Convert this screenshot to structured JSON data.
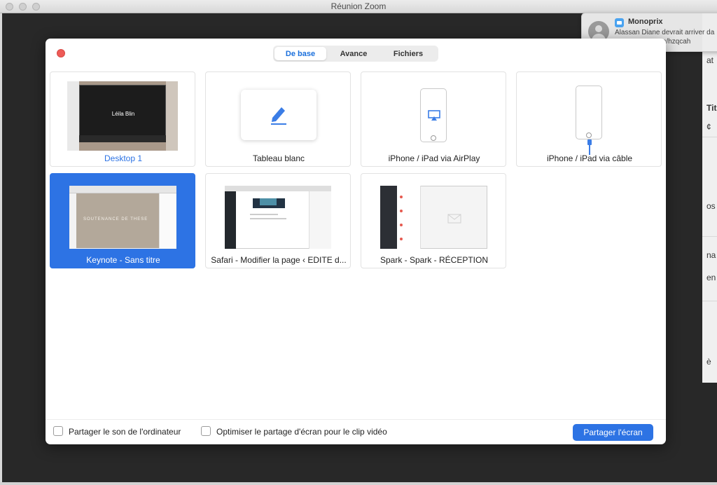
{
  "window": {
    "title": "Réunion Zoom"
  },
  "notification": {
    "sender": "Monoprix",
    "line1": "Alassan Diane devrait arriver da",
    "line2": "art.com/hzqcah"
  },
  "right_app": {
    "fragments": [
      "at",
      "Tit",
      "¢",
      "os",
      "na",
      "en",
      "è"
    ]
  },
  "tabs": [
    {
      "label": "De base",
      "active": true
    },
    {
      "label": "Avance",
      "active": false
    },
    {
      "label": "Fichiers",
      "active": false
    }
  ],
  "tiles": [
    {
      "label": "Desktop 1",
      "thumb_text": "Léila Blin"
    },
    {
      "label": "Tableau blanc"
    },
    {
      "label": "iPhone / iPad via AirPlay"
    },
    {
      "label": "iPhone / iPad via câble"
    },
    {
      "label": "Keynote - Sans titre",
      "thumb_text": "SOUTENANCE DE THESE",
      "selected": true
    },
    {
      "label": "Safari - Modifier la page ‹ EDITE d..."
    },
    {
      "label": "Spark - Spark - RÉCEPTION"
    }
  ],
  "footer": {
    "share_sound": "Partager le son de l'ordinateur",
    "optimize": "Optimiser le partage d'écran pour le clip vidéo",
    "share_button": "Partager l'écran"
  },
  "colors": {
    "accent": "#2d73e4",
    "close": "#ee5b57"
  }
}
